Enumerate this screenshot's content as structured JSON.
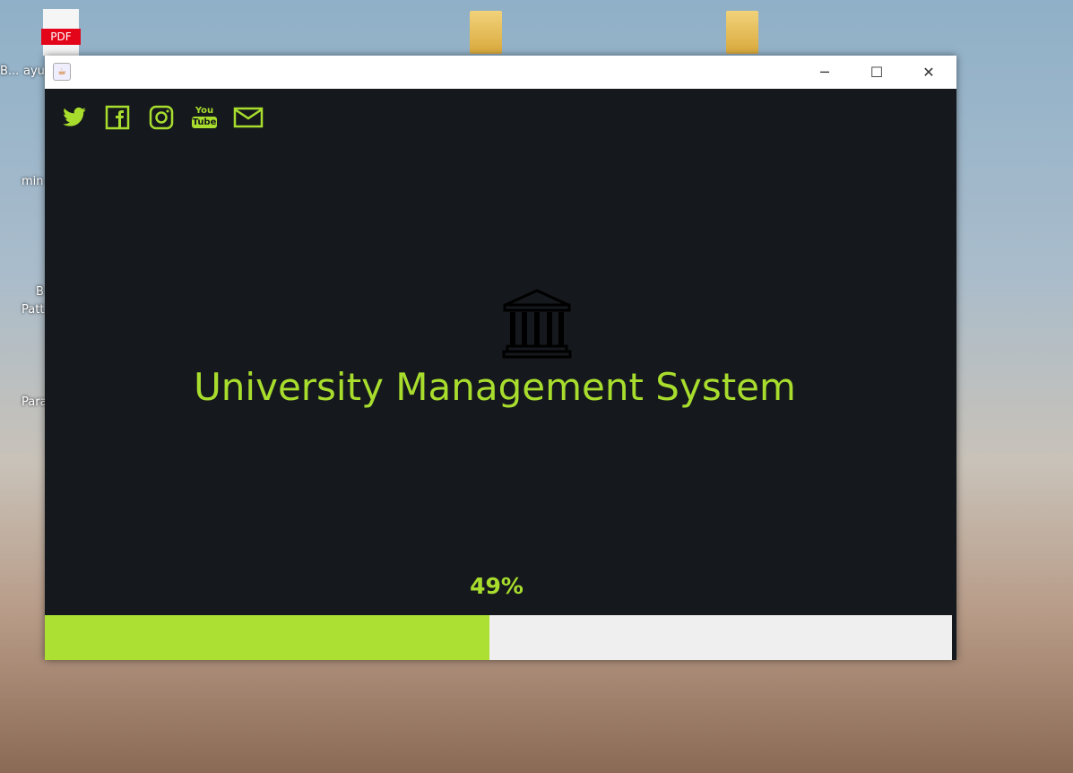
{
  "desktop": {
    "icons": [
      {
        "label": "B..."
      },
      {
        "label": "ayu"
      },
      {
        "label": "min"
      },
      {
        "label": "B"
      },
      {
        "label": "Patt"
      },
      {
        "label": "Para"
      }
    ],
    "pdf_badge": "PDF"
  },
  "window": {
    "title": "",
    "controls": {
      "minimize": "─",
      "maximize": "☐",
      "close": "✕"
    },
    "social_icons": [
      "twitter-icon",
      "facebook-icon",
      "instagram-icon",
      "youtube-icon",
      "mail-icon"
    ],
    "youtube_text": {
      "top": "You",
      "bottom": "Tube"
    },
    "app_title": "University Management System",
    "progress": {
      "value": 49,
      "label": "49%"
    },
    "colors": {
      "accent": "#a8dd2e",
      "background": "#15181c",
      "track": "#efefef"
    }
  }
}
